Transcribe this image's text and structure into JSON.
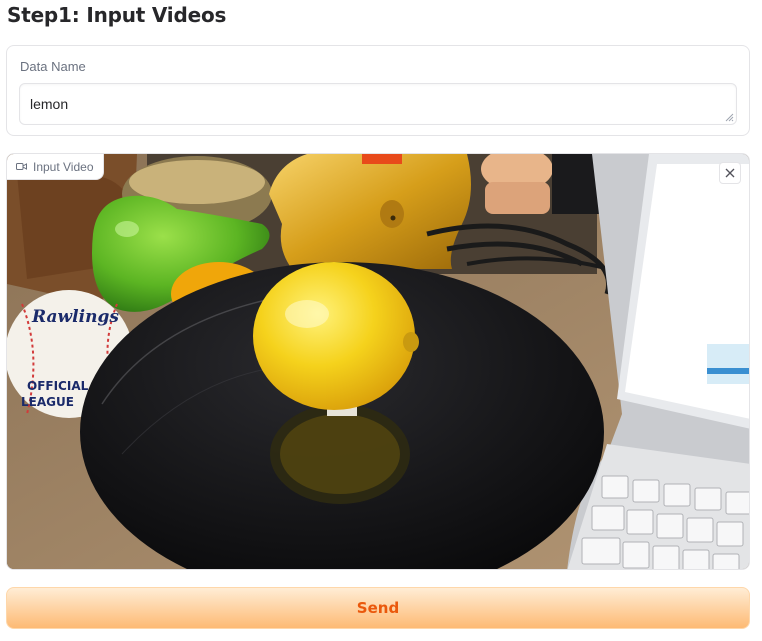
{
  "header": {
    "title": "Step1: Input Videos"
  },
  "data_name": {
    "label": "Data Name",
    "value": "lemon"
  },
  "video": {
    "label": "Input Video",
    "icon": "video-camera-icon",
    "close_icon": "close-icon",
    "ball_text_1": "Rawlings",
    "ball_text_2": "OFFICIAL",
    "ball_text_3": "LEAGUE"
  },
  "actions": {
    "send_label": "Send"
  },
  "colors": {
    "accent": "#ea580c",
    "button_top": "#ffedd5",
    "button_bottom": "#fdba74"
  }
}
